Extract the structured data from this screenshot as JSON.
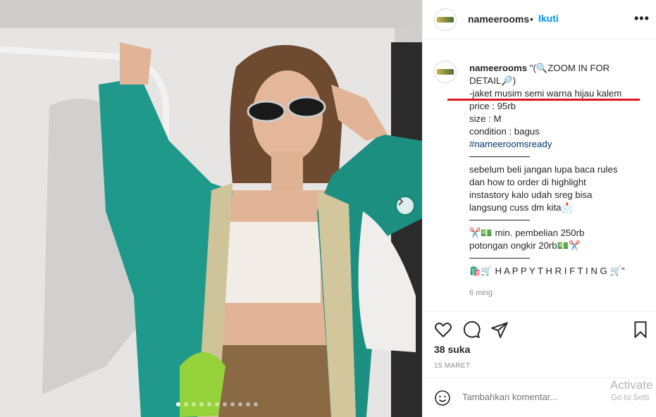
{
  "post": {
    "username": "nameerooms",
    "follow_label": "Ikuti",
    "more_label": "•••",
    "separator": "•"
  },
  "caption": {
    "username": "nameerooms",
    "line1_text": " \"(🔍ZOOM IN FOR",
    "line2_text": "DETAIL🔎)",
    "line3_text": "-jaket musim semi warna hijau kalem",
    "line4_text": "price : 95rb",
    "line5_text": "size : M",
    "line6_text": "condition : bagus",
    "hashtag": "#nameeroomsready",
    "line8_text": "sebelum beli jangan lupa baca rules",
    "line9_text": "dan how to order di highlight",
    "line10_text": "instastory kalo udah sreg bisa",
    "line11_text": "langsung cuss dm kita📩",
    "line12_text": "✂️💵 min. pembelian 250rb",
    "line13_text": "potongan ongkir 20rb💵✂️",
    "line14_text": "🛍️🛒 H A P P Y T H R I F T I N G 🛒\""
  },
  "time_ago": "6 ming",
  "likes": "38 suka",
  "date": "15 MARET",
  "comment": {
    "placeholder": "Tambahkan komentar..."
  },
  "watermark": {
    "line1": "Activate",
    "line2": "Go to Setti"
  },
  "carousel": {
    "total_dots": 11,
    "active_index": 0
  },
  "colors": {
    "accent_blue": "#0095f6",
    "highlight_red": "#e0141e",
    "jacket_green": "#1f9a8a"
  }
}
